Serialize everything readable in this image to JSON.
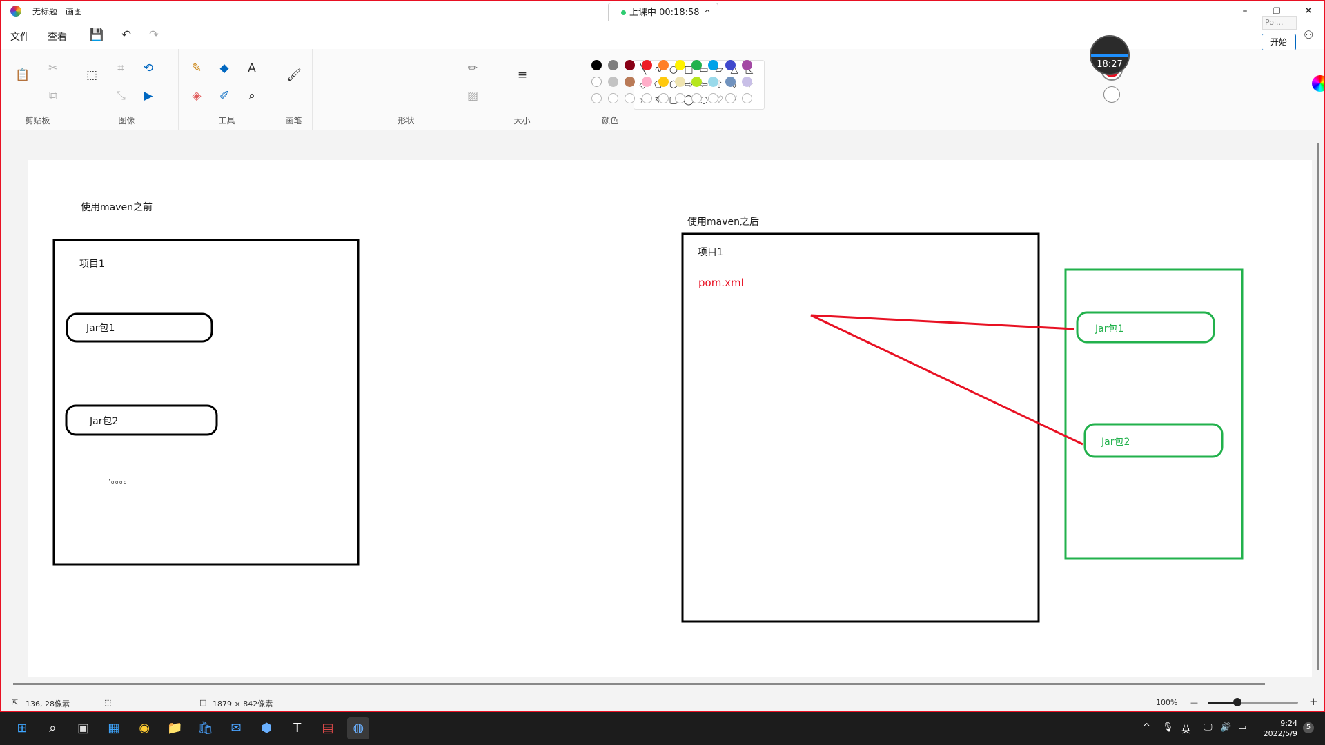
{
  "window": {
    "title": "无标题 - 画图",
    "minimize": "–",
    "maximize": "❐",
    "close": "✕"
  },
  "class_timer": {
    "status": "上课中 00:18:58",
    "chevron": "^"
  },
  "menu": {
    "file": "文件",
    "view": "查看"
  },
  "quick": {
    "save_icon": "💾",
    "undo_icon": "↶",
    "redo_icon": "↷"
  },
  "ribbon": {
    "groups": {
      "clipboard": "剪贴板",
      "image": "图像",
      "tools": "工具",
      "brushes": "画笔",
      "shapes": "形状",
      "size": "大小",
      "colors": "颜色"
    },
    "tool_glyphs": {
      "paste": "📋",
      "cut": "✂",
      "copy": "⧉",
      "select": "⬚",
      "crop": "⌗",
      "rotate": "⟲",
      "resize": "⤡",
      "flip": "▶",
      "pencil": "✎",
      "fill": "◆",
      "text": "A",
      "eraser": "◈",
      "picker": "✐",
      "magnifier": "⌕",
      "brush": "🖌",
      "outline": "✏",
      "shape_fill": "▨",
      "size_lines": "≡"
    },
    "shapes": [
      "╲",
      "∿",
      "○",
      "□",
      "▭",
      "▱",
      "△",
      "◺",
      "◇",
      "⬠",
      "⬡",
      "⇨",
      "⇦",
      "⇧",
      "⇩",
      "✧",
      "☆",
      "✡",
      "▢",
      "◯",
      "◌",
      "♡",
      "⚡"
    ],
    "primary_color": "#e81123",
    "palette_row1": [
      "#000000",
      "#7f7f7f",
      "#880015",
      "#ed1c24",
      "#ff7f27",
      "#fff200",
      "#22b14c",
      "#00a2e8",
      "#3f48cc",
      "#a349a4"
    ],
    "palette_row2": [
      "#ffffff",
      "#c3c3c3",
      "#b97a57",
      "#ffaec9",
      "#ffc90e",
      "#efe4b0",
      "#b5e61d",
      "#99d9ea",
      "#7092be",
      "#c8bfe7"
    ]
  },
  "canvas": {
    "before_title": "使用maven之前",
    "before_project": "项目1",
    "before_jar1": "Jar包1",
    "before_jar2": "Jar包2",
    "ellipsis": "·。。。。",
    "after_title": "使用maven之后",
    "after_project": "项目1",
    "pom": "pom.xml",
    "repo_jar1": "Jar包1",
    "repo_jar2": "Jar包2",
    "colors": {
      "red": "#e81123",
      "green": "#22b14c"
    }
  },
  "status": {
    "cursor_pos": "136, 28像素",
    "canvas_size": "1879 × 842像素",
    "zoom": "100%",
    "zoom_minus": "—",
    "zoom_plus": "+",
    "zoom_fraction": 0.32
  },
  "overlay": {
    "timer": "18:27",
    "rec_name": "Poi...",
    "rec_start": "开始"
  },
  "taskbar": {
    "icons": [
      "⊞",
      "⌕",
      "▣",
      "▦",
      "◉",
      "📁",
      "🛍",
      "✉",
      "⬢",
      "T",
      "▤",
      "◍"
    ],
    "tray_chevron": "^",
    "mic": "🎙",
    "ime": "英",
    "net": "🖵",
    "volume": "🔊",
    "battery": "▭",
    "time": "9:24",
    "date": "2022/5/9",
    "badge": "5"
  }
}
